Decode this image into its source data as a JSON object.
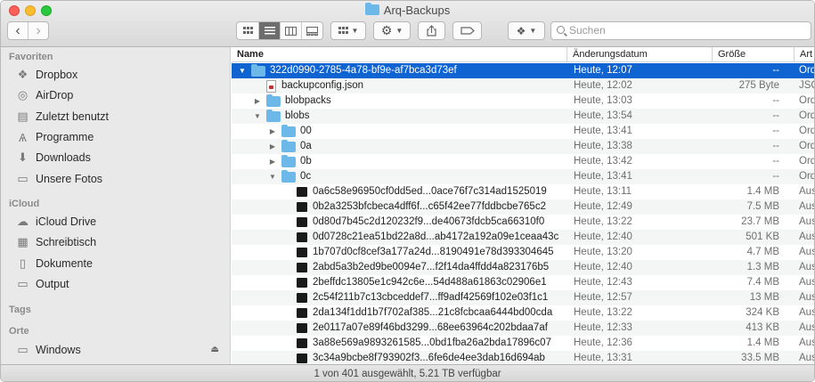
{
  "window": {
    "title": "Arq-Backups"
  },
  "toolbar": {
    "back": "‹",
    "forward": "›",
    "search_placeholder": "Suchen"
  },
  "sidebar": {
    "sections": [
      {
        "label": "Favoriten"
      },
      {
        "label": "iCloud"
      },
      {
        "label": "Tags"
      },
      {
        "label": "Orte"
      }
    ],
    "favorites": [
      {
        "label": "Dropbox",
        "icon": "dropbox-icon"
      },
      {
        "label": "AirDrop",
        "icon": "airdrop-icon"
      },
      {
        "label": "Zuletzt benutzt",
        "icon": "recents-icon"
      },
      {
        "label": "Programme",
        "icon": "applications-icon"
      },
      {
        "label": "Downloads",
        "icon": "downloads-icon"
      },
      {
        "label": "Unsere Fotos",
        "icon": "folder-icon"
      }
    ],
    "icloud": [
      {
        "label": "iCloud Drive",
        "icon": "cloud-icon"
      },
      {
        "label": "Schreibtisch",
        "icon": "desktop-icon"
      },
      {
        "label": "Dokumente",
        "icon": "documents-icon"
      },
      {
        "label": "Output",
        "icon": "folder-icon"
      }
    ],
    "locations": [
      {
        "label": "Windows",
        "icon": "disk-icon"
      }
    ]
  },
  "columns": {
    "name": "Name",
    "date": "Änderungsdatum",
    "size": "Größe",
    "kind": "Art"
  },
  "rows": [
    {
      "name": "322d0990-2785-4a78-bf9e-af7bca3d73ef",
      "date": "Heute, 12:07",
      "size": "--",
      "kind": "Ordn",
      "indent": 0,
      "disc": "▼",
      "type": "folder",
      "selected": true
    },
    {
      "name": "backupconfig.json",
      "date": "Heute, 12:02",
      "size": "275 Byte",
      "kind": "JSON",
      "indent": 1,
      "disc": "",
      "type": "file"
    },
    {
      "name": "blobpacks",
      "date": "Heute, 13:03",
      "size": "--",
      "kind": "Ordn",
      "indent": 1,
      "disc": "▶",
      "type": "folder"
    },
    {
      "name": "blobs",
      "date": "Heute, 13:54",
      "size": "--",
      "kind": "Ordn",
      "indent": 1,
      "disc": "▼",
      "type": "folder"
    },
    {
      "name": "00",
      "date": "Heute, 13:41",
      "size": "--",
      "kind": "Ordn",
      "indent": 2,
      "disc": "▶",
      "type": "folder"
    },
    {
      "name": "0a",
      "date": "Heute, 13:38",
      "size": "--",
      "kind": "Ordn",
      "indent": 2,
      "disc": "▶",
      "type": "folder"
    },
    {
      "name": "0b",
      "date": "Heute, 13:42",
      "size": "--",
      "kind": "Ordn",
      "indent": 2,
      "disc": "▶",
      "type": "folder"
    },
    {
      "name": "0c",
      "date": "Heute, 13:41",
      "size": "--",
      "kind": "Ordn",
      "indent": 2,
      "disc": "▼",
      "type": "folder"
    },
    {
      "name": "0a6c58e96950cf0dd5ed...0ace76f7c314ad1525019",
      "date": "Heute, 13:11",
      "size": "1.4 MB",
      "kind": "Ausf",
      "indent": 3,
      "disc": "",
      "type": "blob"
    },
    {
      "name": "0b2a3253bfcbeca4dff6f...c65f42ee77fddbcbe765c2",
      "date": "Heute, 12:49",
      "size": "7.5 MB",
      "kind": "Ausf",
      "indent": 3,
      "disc": "",
      "type": "blob"
    },
    {
      "name": "0d80d7b45c2d120232f9...de40673fdcb5ca66310f0",
      "date": "Heute, 13:22",
      "size": "23.7 MB",
      "kind": "Ausf",
      "indent": 3,
      "disc": "",
      "type": "blob"
    },
    {
      "name": "0d0728c21ea51bd22a8d...ab4172a192a09e1ceaa43c",
      "date": "Heute, 12:40",
      "size": "501 KB",
      "kind": "Ausf",
      "indent": 3,
      "disc": "",
      "type": "blob"
    },
    {
      "name": "1b707d0cf8cef3a177a24d...8190491e78d393304645",
      "date": "Heute, 13:20",
      "size": "4.7 MB",
      "kind": "Ausf",
      "indent": 3,
      "disc": "",
      "type": "blob"
    },
    {
      "name": "2abd5a3b2ed9be0094e7...f2f14da4ffdd4a823176b5",
      "date": "Heute, 12:40",
      "size": "1.3 MB",
      "kind": "Ausf",
      "indent": 3,
      "disc": "",
      "type": "blob"
    },
    {
      "name": "2beffdc13805e1c942c6e...54d488a61863c02906e1",
      "date": "Heute, 12:43",
      "size": "7.4 MB",
      "kind": "Ausf",
      "indent": 3,
      "disc": "",
      "type": "blob"
    },
    {
      "name": "2c54f211b7c13cbceddef7...ff9adf42569f102e03f1c1",
      "date": "Heute, 12:57",
      "size": "13 MB",
      "kind": "Ausf",
      "indent": 3,
      "disc": "",
      "type": "blob"
    },
    {
      "name": "2da134f1dd1b7f702af385...21c8fcbcaa6444bd00cda",
      "date": "Heute, 13:22",
      "size": "324 KB",
      "kind": "Ausf",
      "indent": 3,
      "disc": "",
      "type": "blob"
    },
    {
      "name": "2e0117a07e89f46bd3299...68ee63964c202bdaa7af",
      "date": "Heute, 12:33",
      "size": "413 KB",
      "kind": "Ausf",
      "indent": 3,
      "disc": "",
      "type": "blob"
    },
    {
      "name": "3a88e569a9893261585...0bd1fba26a2bda17896c07",
      "date": "Heute, 12:36",
      "size": "1.4 MB",
      "kind": "Ausf",
      "indent": 3,
      "disc": "",
      "type": "blob"
    },
    {
      "name": "3c34a9bcbe8f793902f3...6fe6de4ee3dab16d694ab",
      "date": "Heute, 13:31",
      "size": "33.5 MB",
      "kind": "Ausf",
      "indent": 3,
      "disc": "",
      "type": "blob"
    }
  ],
  "status": "1 von 401 ausgewählt, 5.21 TB verfügbar"
}
